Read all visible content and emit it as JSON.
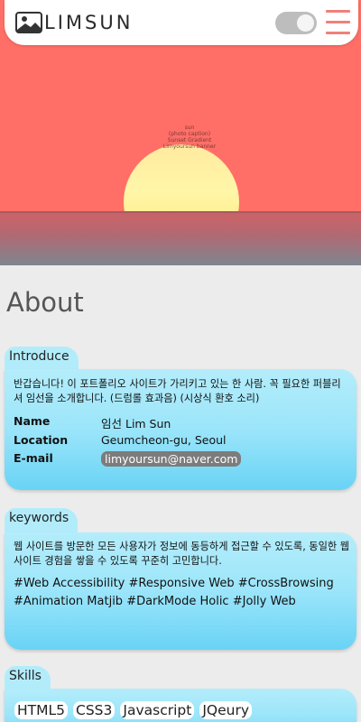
{
  "header": {
    "logo_text": "LIMSUN",
    "theme_toggle": "off",
    "menu_icon": "hamburger-icon"
  },
  "hero": {
    "caption_lines": [
      "sun",
      "(photo caption)",
      "Sunset Gradient",
      "Limyoursun banner"
    ]
  },
  "about": {
    "title": "About",
    "introduce": {
      "tab_label": "Introduce",
      "text": "반갑습니다! 이 포트폴리오 사이트가 가리키고 있는 한 사람. 꼭 필요한 퍼블리셔 임선을 소개합니다. (드럼롤 효과음) (시상식 환호 소리)",
      "rows": [
        {
          "label": "Name",
          "value": "임선 Lim Sun"
        },
        {
          "label": "Location",
          "value": "Geumcheon-gu, Seoul"
        },
        {
          "label": "E-mail",
          "value": "limyoursun@naver.com"
        }
      ]
    },
    "keywords": {
      "tab_label": "keywords",
      "text": "웹 사이트를 방문한 모든 사용자가 정보에 동등하게 접근할 수 있도록, 동일한 웹 사이트 경험을 쌓을 수 있도록 꾸준히 고민합니다.",
      "tags": "#Web Accessibility #Responsive Web #CrossBrowsing #Animation Matjib #DarkMode Holic #Jolly Web"
    },
    "skills": {
      "tab_label": "Skills",
      "items": [
        "HTML5",
        "CSS3",
        "Javascript",
        "JQeury"
      ]
    }
  },
  "colors": {
    "hero_bg": "#ff6f67",
    "accent": "#f0807a",
    "card": "#9be5fa",
    "toggle": "#bdbdbd"
  }
}
